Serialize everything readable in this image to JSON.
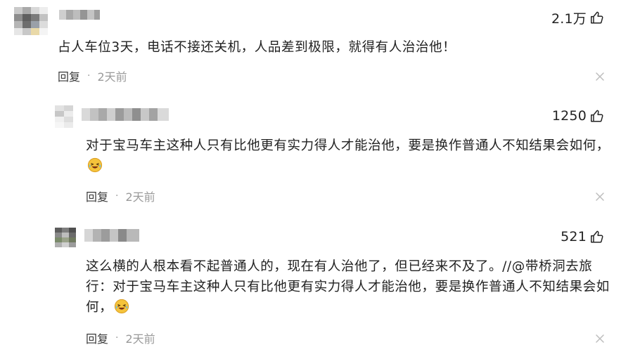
{
  "comments": [
    {
      "likes": "2.1万",
      "text": "占人车位3天，电话不接还关机，人品差到极限，就得有人治治他！",
      "reply_label": "回复",
      "separator": "·",
      "time": "2天前"
    },
    {
      "likes": "1250",
      "text": "对于宝马车主这种人只有比他更有实力得人才能治他，要是换作普通人不知结果会如何，",
      "reply_label": "回复",
      "separator": "·",
      "time": "2天前"
    },
    {
      "likes": "521",
      "text": "这么横的人根本看不起普通人的，现在有人治他了，但已经来不及了。//@带桥洞去旅行：对于宝马车主这种人只有比他更有实力得人才能治他，要是换作普通人不知结果会如何，",
      "reply_label": "回复",
      "separator": "·",
      "time": "2天前"
    }
  ],
  "icons": {
    "like": "thumbs-up-outline-icon",
    "close": "close-x-icon",
    "emoji": "laughing-crying-emoji-icon"
  },
  "colors": {
    "text": "#222222",
    "meta_gray": "#9a9a9a",
    "reply": "#3a3a3a",
    "emoji_yellow": "#f5c33b"
  }
}
